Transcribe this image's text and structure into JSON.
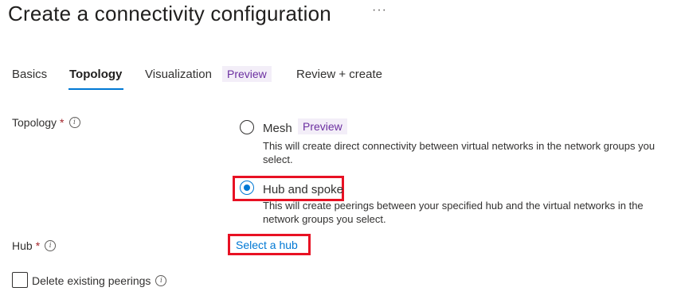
{
  "header": {
    "title": "Create a connectivity configuration",
    "more_label": "···"
  },
  "tabs": [
    {
      "label": "Basics"
    },
    {
      "label": "Topology"
    },
    {
      "label": "Visualization"
    },
    {
      "label": "Review + create"
    }
  ],
  "tab_preview_badge": "Preview",
  "form": {
    "topology": {
      "label": "Topology",
      "required_mark": "*",
      "options": [
        {
          "label": "Mesh",
          "badge": "Preview",
          "description": "This will create direct connectivity between virtual networks in the network groups you select.",
          "selected": false
        },
        {
          "label": "Hub and spoke",
          "description": "This will create peerings between your specified hub and the virtual networks in the network groups you select.",
          "selected": true
        }
      ]
    },
    "hub": {
      "label": "Hub",
      "required_mark": "*",
      "link_label": "Select a hub"
    },
    "delete_peerings": {
      "label": "Delete existing peerings",
      "checked": false
    }
  },
  "colors": {
    "accent": "#0078d4",
    "highlight": "#e81123",
    "preview_bg": "#f3eef8",
    "preview_text": "#6b2fa0"
  },
  "icons": {
    "info": "info-icon",
    "more": "more-icon"
  }
}
